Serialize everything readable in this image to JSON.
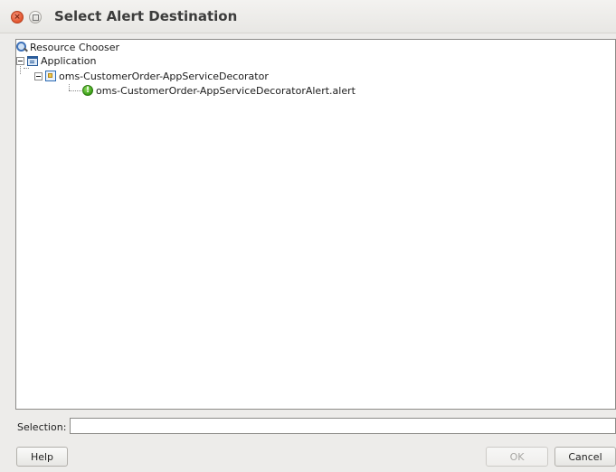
{
  "window": {
    "title": "Select Alert Destination",
    "close_icon": "close-icon",
    "maximize_icon": "maximize-icon"
  },
  "tree": {
    "root": {
      "label": "Resource Chooser",
      "icon": "search-icon"
    },
    "application": {
      "label": "Application",
      "icon": "application-icon",
      "expanded": true
    },
    "project": {
      "label": "oms-CustomerOrder-AppServiceDecorator",
      "icon": "project-icon",
      "expanded": true
    },
    "alert": {
      "label": "oms-CustomerOrder-AppServiceDecoratorAlert.alert",
      "icon": "alert-icon"
    }
  },
  "selection": {
    "label": "Selection:",
    "value": ""
  },
  "buttons": {
    "help": "Help",
    "ok": "OK",
    "cancel": "Cancel"
  }
}
